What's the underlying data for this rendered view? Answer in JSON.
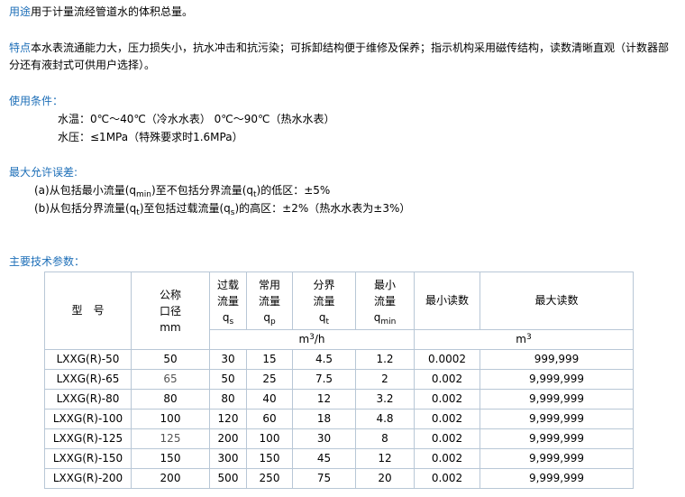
{
  "usage": {
    "label": "用途",
    "text": "用于计量流经管道水的体积总量。"
  },
  "features": {
    "label": "特点",
    "line1": "本水表流通能力大，压力损失小，抗水冲击和抗污染；可拆卸结构便于维修及保养；指示机构采用磁传结构，读数清晰直观（计数器部",
    "line2": "分还有液封式可供用户选择）。"
  },
  "conditions": {
    "title": "使用条件：",
    "water_temp": "水温：0℃～40℃（冷水水表）  0℃～90℃（热水水表）",
    "water_pressure": "水压：≤1MPa（特殊要求时1.6MPa）"
  },
  "error": {
    "title": "最大允许误差:",
    "a_pre": "(a)从包括最小流量(q",
    "a_sub1": "min",
    "a_mid": ")至不包括分界流量(q",
    "a_sub2": "t",
    "a_post": ")的低区：±5%",
    "b_pre": "(b)从包括分界流量(q",
    "b_sub1": "t",
    "b_mid": ")至包括过载流量(q",
    "b_sub2": "s",
    "b_post": ")的高区：±2%（热水水表为±3%）"
  },
  "params": {
    "title": "主要技术参数：",
    "headers": {
      "model": "型　号",
      "diameter": [
        "公称",
        "口径",
        "mm"
      ],
      "overload": [
        "过载",
        "流量",
        "q",
        "s"
      ],
      "common": [
        "常用",
        "流量",
        "q",
        "p"
      ],
      "boundary": [
        "分界",
        "流量",
        "q",
        "t"
      ],
      "minimum": [
        "最小",
        "流量",
        "q",
        "min"
      ],
      "min_reading": "最小读数",
      "max_reading": "最大读数",
      "flow_unit_base": "m",
      "flow_unit_exp": "3",
      "flow_unit_tail": "/h",
      "reading_unit_base": "m",
      "reading_unit_exp": "3"
    },
    "rows": [
      [
        "LXXG(R)-50",
        "50",
        "30",
        "15",
        "4.5",
        "1.2",
        "0.0002",
        "999,999"
      ],
      [
        "LXXG(R)-65",
        "65",
        "50",
        "25",
        "7.5",
        "2",
        "0.002",
        "9,999,999"
      ],
      [
        "LXXG(R)-80",
        "80",
        "80",
        "40",
        "12",
        "3.2",
        "0.002",
        "9,999,999"
      ],
      [
        "LXXG(R)-100",
        "100",
        "120",
        "60",
        "18",
        "4.8",
        "0.002",
        "9,999,999"
      ],
      [
        "LXXG(R)-125",
        "125",
        "200",
        "100",
        "30",
        "8",
        "0.002",
        "9,999,999"
      ],
      [
        "LXXG(R)-150",
        "150",
        "300",
        "150",
        "45",
        "12",
        "0.002",
        "9,999,999"
      ],
      [
        "LXXG(R)-200",
        "200",
        "500",
        "250",
        "75",
        "20",
        "0.002",
        "9,999,999"
      ]
    ]
  },
  "colors": {
    "accent": "#1e6fb8",
    "table_border": "#b8c7d6",
    "light_text": "#555555"
  }
}
